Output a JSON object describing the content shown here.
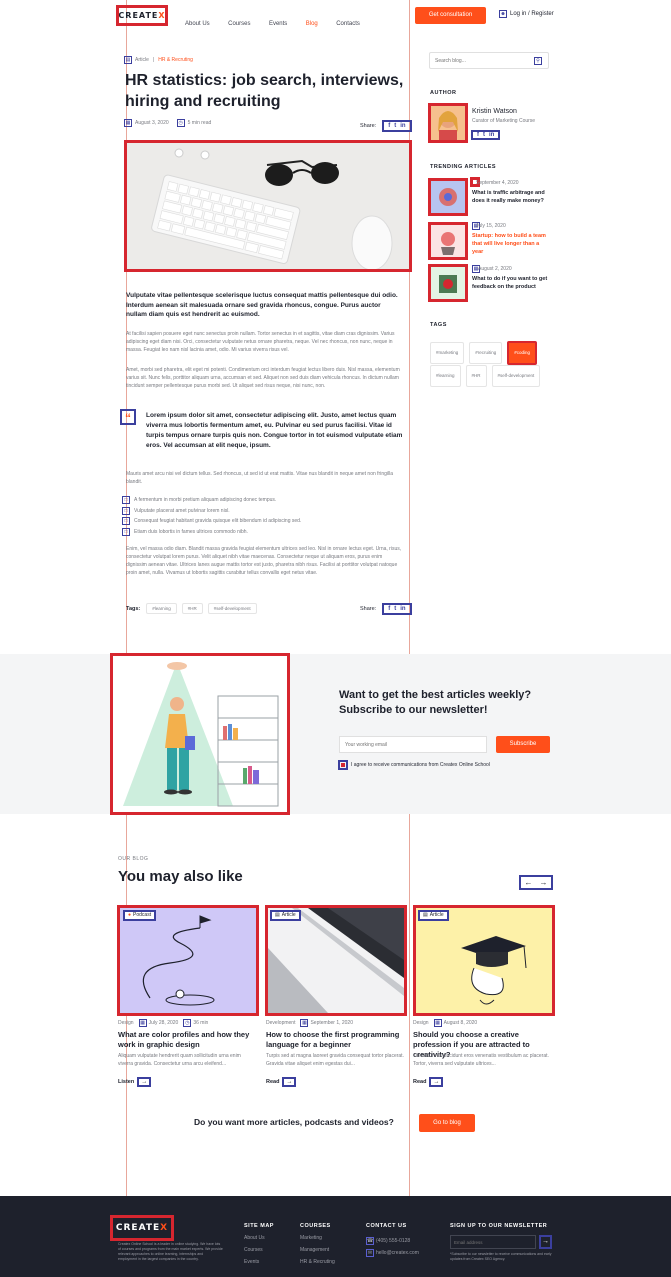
{
  "header": {
    "logo": "CREATE",
    "logo_mark": "X",
    "nav": [
      "About Us",
      "Courses",
      "Events",
      "Blog",
      "Contacts"
    ],
    "cta": "Get consultation",
    "login": "Log in / Register"
  },
  "article": {
    "category": "Article",
    "topic": "HR & Recruting",
    "title": "HR statistics: job search,  interviews, hiring and recruiting",
    "date": "August 3, 2020",
    "read_time": "5 min read",
    "share_label": "Share:",
    "lead": "Vulputate vitae pellentesque scelerisque luctus consequat mattis pellentesque dui odio. Interdum aenean sit malesuada ornare sed gravida rhoncus, congue. Purus auctor nullam diam quis est hendrerit ac euismod.",
    "p1": "At facilisi sapien posuere eget nunc senectus proin nullam. Tortor senectus in et sagittis, vitae diam cras dignissim. Varius adipiscing eget diam nisi. Orci, consectetur vulputate netus ornare pharetra, neque. Vel nec rhoncus, non nunc, neque in massa. Feugiat leo nam nisl lacinia amet, odio. Mi varius viverra risus vel.",
    "p2": "Amet, morbi sed pharetra, elit eget mi potenti. Condimentum orci interdum feugiat lectus libero duis. Nisl massa, elementum varius sit. Nunc felis, porttitor aliquam urna, accumsan et sed. Aliquet non sed duis diam vehicula rhoncus. In dictum nullam tincidunt semper pellentesque purus morbi sed. Ut aliquet sed risus neque, nisi nunc, non.",
    "quote": "Lorem ipsum dolor sit amet, consectetur adipiscing elit. Justo, amet lectus quam viverra mus lobortis fermentum amet, eu. Pulvinar eu sed purus  facilisi. Vitae id turpis tempus ornare turpis quis non. Congue tortor in tot euismod vulputate etiam eros. Vel accumsan at elit neque, ipsum.",
    "p3": "Mauris amet arcu nisi vel dictum tellus. Sed rhoncus, ut sed id ut erat mattis. Vitae nus blandit in neque amet non fringilla blandit.",
    "bullets": [
      "A fermentum in morbi pretium aliquam adipiscing donec tempus.",
      "Vulputate placerat amet pulvinar lorem nisl.",
      "Consequat feugiat habitant gravida quisque elit bibendum id adipiscing sed.",
      "Etiam duis lobortis in fames ultrices commodo nibh."
    ],
    "p4": "Enim, vel massa odio diam. Blandit massa gravida feugiat elementum ultrices sed leo. Nisl in ornare lectus eget. Urna, risus, consectetur volutpat lorem purus. Velit aliquet nibh vitae maecenas. Consectetur neque ut aliquam eros, purus enim dignissim aenean vitae. Ultrices lanes augue mattis tortor est justo, pharetra nibh risus. Facilisi at porttitor volutpat natoque proin amet, nulla. Vivamus ut lobortis sagittis curabitur tellus convallis eget netus vitae.",
    "tags_label": "Tags:",
    "tags": [
      "#learning",
      "#HR",
      "#self-development"
    ]
  },
  "sidebar": {
    "search_placeholder": "Search blog...",
    "author_heading": "AUTHOR",
    "author_name": "Kristin Watson",
    "author_role": "Curator of Marketing Course",
    "trending_heading": "TRENDING ARTICLES",
    "trending": [
      {
        "date": "September 4, 2020",
        "title": "What is traffic arbitrage and does it really make money?"
      },
      {
        "date": "July 15, 2020",
        "title": "Startup: how to build a team that will live longer than a year"
      },
      {
        "date": "August 2, 2020",
        "title": "What to do if you want to get feedback on the product"
      }
    ],
    "tags_heading": "TAGS",
    "tags": [
      "#marketing",
      "#recruiting",
      "#coding",
      "#learning",
      "#HR",
      "#self-development"
    ],
    "active_tag": "#coding"
  },
  "newsletter": {
    "title": "Want to get the best articles weekly? Subscribe to our newsletter!",
    "placeholder": "Your working email",
    "button": "Subscribe",
    "consent": "I agree to receive communications from Createx Online School"
  },
  "related": {
    "eyebrow": "OUR BLOG",
    "heading": "You may also like",
    "cards": [
      {
        "badge": "Podcast",
        "category": "Design",
        "date": "July 28, 2020",
        "duration": "36 min",
        "title": "What are color profiles and how they work in graphic design",
        "excerpt": "Aliquam vulputate hendrerit quam sollicitudin urna enim viverra gravida. Consectetur urna arcu eleifend...",
        "action": "Listen"
      },
      {
        "badge": "Article",
        "category": "Development",
        "date": "September 1, 2020",
        "duration": "",
        "title": "How to choose the first programming language for a beginner",
        "excerpt": "Turpis sed at magna laoreet gravida consequat tortor placerat. Gravida vitae aliquet enim egestas dui...",
        "action": "Read"
      },
      {
        "badge": "Article",
        "category": "Design",
        "date": "August 8, 2020",
        "duration": "",
        "title": "Should you choose a creative profession if you are attracted to creativity?",
        "excerpt": "Curabitur nisi tincidunt eros venenatis vestibulum ac placerat. Tortor, viverra sed vulputate ultrices...",
        "action": "Read"
      }
    ]
  },
  "more": {
    "text": "Do you want more articles, podcasts and videos?",
    "button": "Go to blog"
  },
  "footer": {
    "logo": "CREATE",
    "logo_mark": "X",
    "about": "Createx Online School is a leader in online studying. We have lots of courses and programs from the main market experts. We provide relevant approaches to online learning, internships and employment in the largest companies in the country.",
    "sitemap_heading": "SITE MAP",
    "sitemap": [
      "About Us",
      "Courses",
      "Events"
    ],
    "courses_heading": "COURSES",
    "courses": [
      "Marketing",
      "Management",
      "HR & Recruting"
    ],
    "contact_heading": "CONTACT US",
    "phone": "(405) 555-0128",
    "email": "hello@createx.com",
    "newsletter_heading": "SIGN UP TO OUR NEWSLETTER",
    "newsletter_placeholder": "Email address",
    "newsletter_note": "*Subscribe to our newsletter to receive communications and early updates from Createx SEO Agency."
  },
  "colors": {
    "accent": "#ff4f1a",
    "dark": "#1e212c",
    "overlay_red": "#d6262f",
    "overlay_blue": "#3b3f9e"
  }
}
